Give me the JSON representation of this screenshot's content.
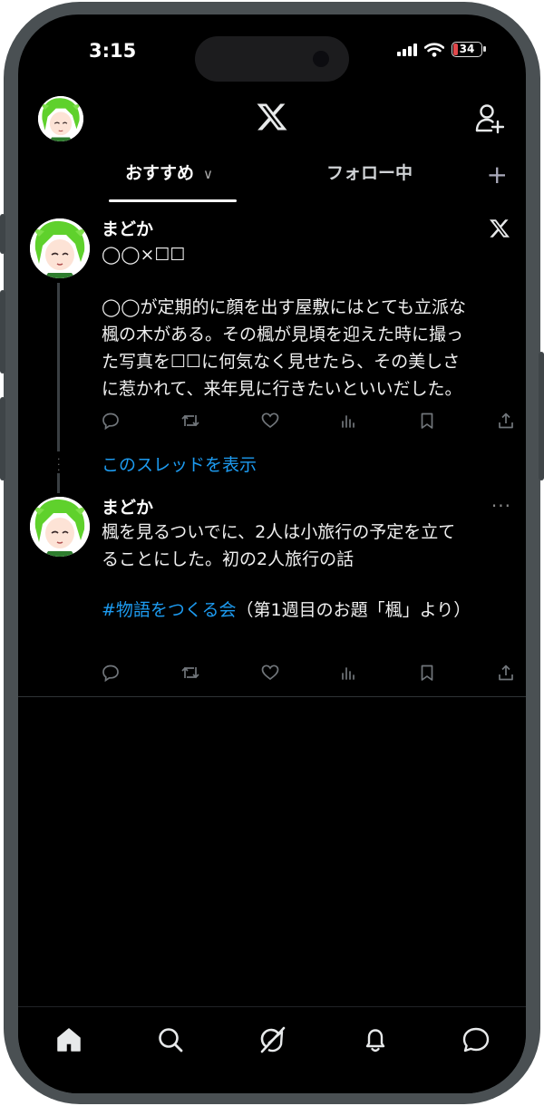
{
  "status": {
    "time": "3:15",
    "battery": "34"
  },
  "header": {
    "logo": "x-logo",
    "add_user": "add-user-icon"
  },
  "tabs": [
    {
      "label": "おすすめ",
      "active": true
    },
    {
      "label": "フォロー中",
      "active": false
    }
  ],
  "posts": [
    {
      "author": "まどか",
      "subtitle": "◯◯×☐☐",
      "body": [
        "◯◯が定期的に顔を出す屋敷にはとても立派な",
        "楓の木がある。その楓が見頃を迎えた時に撮っ",
        "た写真を☐☐に何気なく見せたら、その美しさ",
        "に惹かれて、来年見に行きたいといいだした。"
      ],
      "badge_icon": "x-icon"
    },
    {
      "author": "まどか",
      "more": "···",
      "body": [
        "楓を見るついでに、2人は小旅行の予定を立て",
        "ることにした。初の2人旅行の話"
      ],
      "hashtag": "#物語をつくる会",
      "tail": "（第1週目のお題「楓」より）"
    }
  ],
  "thread": {
    "show_label": "このスレッドを表示"
  },
  "colors": {
    "accent": "#1d9bf0",
    "background": "#000000",
    "frame": "#4a5053"
  },
  "nav": [
    "home-icon",
    "search-icon",
    "grok-icon",
    "notifications-icon",
    "messages-icon"
  ]
}
